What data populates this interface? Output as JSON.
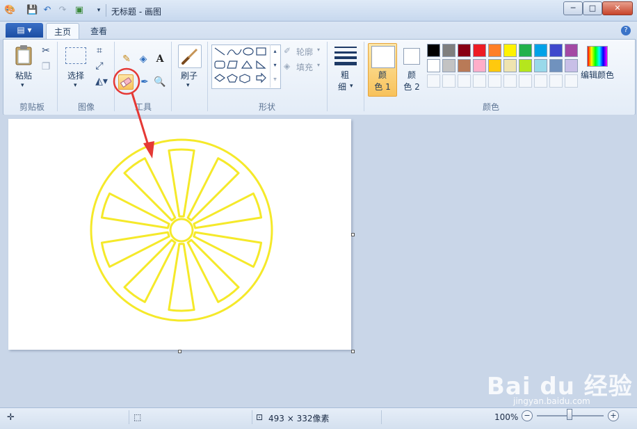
{
  "window": {
    "title": "无标题 - 画图",
    "minimize": "─",
    "maximize": "□",
    "close": "✕"
  },
  "tabs": {
    "app_menu": "▤ ▾",
    "home": "主页",
    "view": "查看"
  },
  "groups": {
    "clipboard": {
      "label": "剪贴板",
      "paste": "粘贴"
    },
    "image": {
      "label": "图像",
      "select": "选择"
    },
    "tools": {
      "label": "工具"
    },
    "brush": {
      "label": "刷子"
    },
    "shapes": {
      "label": "形状",
      "outline": "轮廓",
      "fill": "填充"
    },
    "size": {
      "label_top": "粗",
      "label_bottom": "细"
    },
    "colors": {
      "label": "颜色",
      "color1_top": "颜",
      "color1_bottom": "色 1",
      "color2_top": "颜",
      "color2_bottom": "色 2",
      "edit": "编辑颜色",
      "color1": "#ffffff",
      "color2": "#ffffff",
      "palette_row1": [
        "#000000",
        "#7f7f7f",
        "#880015",
        "#ed1c24",
        "#ff7f27",
        "#fff200",
        "#22b14c",
        "#00a2e8",
        "#3f48cc",
        "#a349a4"
      ],
      "palette_row2": [
        "#ffffff",
        "#c3c3c3",
        "#b97a57",
        "#ffaec9",
        "#ffc90e",
        "#efe4b0",
        "#b5e61d",
        "#99d9ea",
        "#7092be",
        "#c8bfe7"
      ]
    }
  },
  "drawing": {
    "stroke_color": "#f5e92a",
    "highlight_color": "#e53935"
  },
  "statusbar": {
    "canvas_size": "493 × 332像素",
    "zoom": "100%",
    "zoom_out": "−",
    "zoom_in": "+"
  },
  "watermark": {
    "brand": "Bai du 经验",
    "url": "jingyan.baidu.com"
  }
}
